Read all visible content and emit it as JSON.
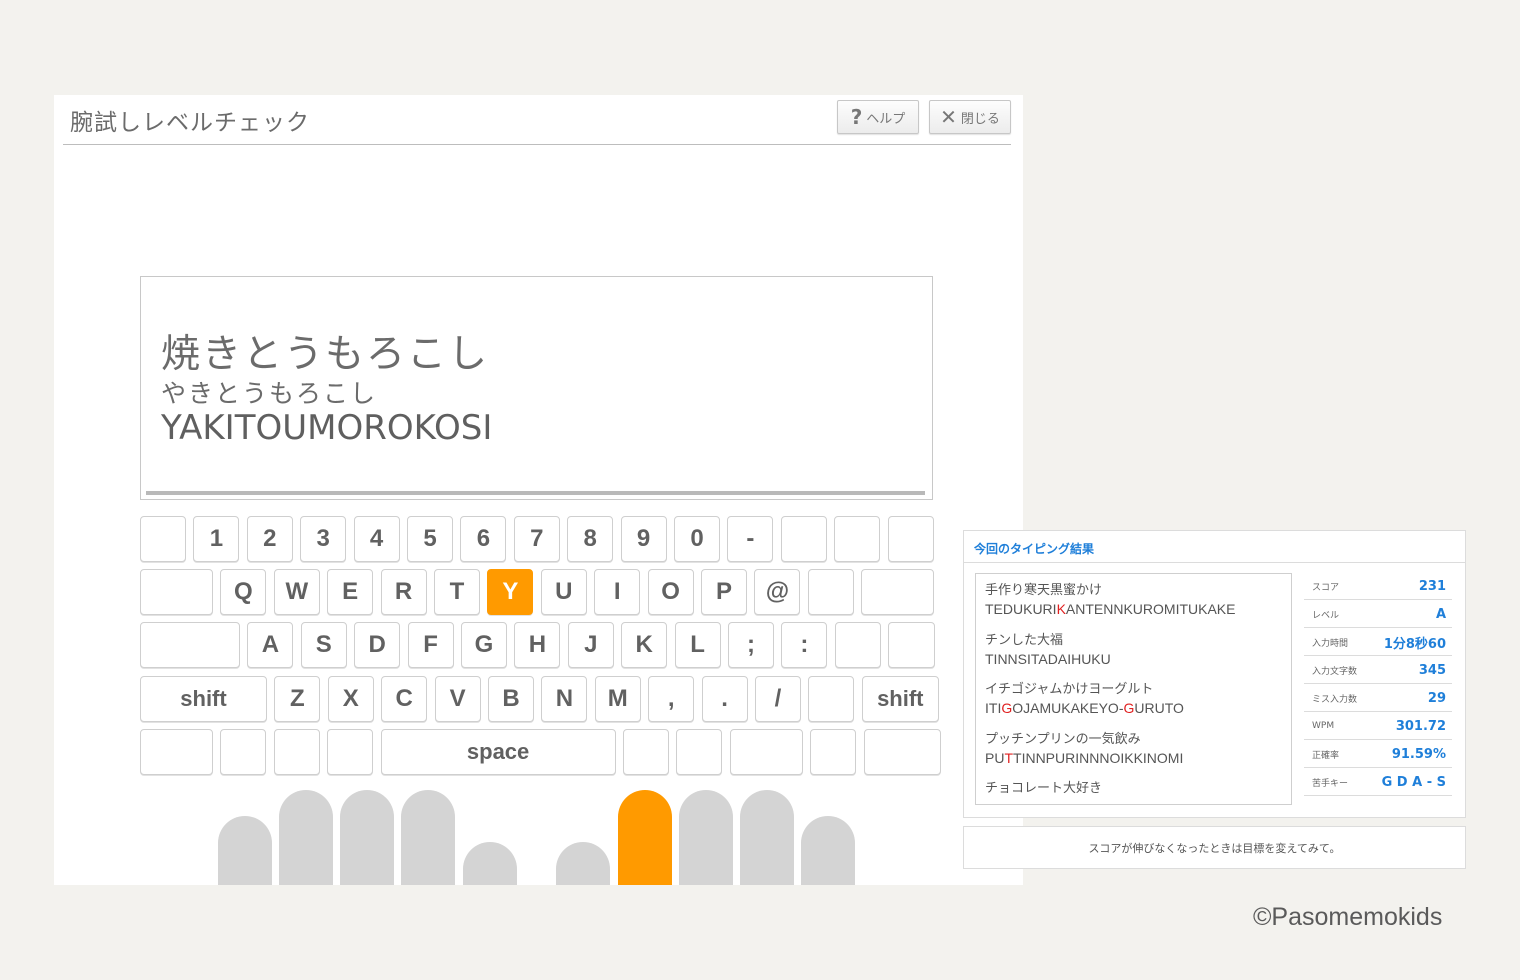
{
  "header": {
    "title": "腕試しレベルチェック",
    "help_icon": "?",
    "help_label": "ヘルプ",
    "close_icon": "✕",
    "close_label": "閉じる"
  },
  "word": {
    "kanji": "焼きとうもろこし",
    "kana": "やきとうもろこし",
    "romaji": "YAKITOUMOROKOSI",
    "progress": 1.0
  },
  "keyboard": {
    "active_key": "Y",
    "row1": [
      "",
      "1",
      "2",
      "3",
      "4",
      "5",
      "6",
      "7",
      "8",
      "9",
      "0",
      "-",
      "",
      "",
      ""
    ],
    "row2": [
      "",
      "Q",
      "W",
      "E",
      "R",
      "T",
      "Y",
      "U",
      "I",
      "O",
      "P",
      "@",
      "",
      ""
    ],
    "row3": [
      "",
      "A",
      "S",
      "D",
      "F",
      "G",
      "H",
      "J",
      "K",
      "L",
      ";",
      ":",
      "",
      ""
    ],
    "row4": [
      "shift",
      "Z",
      "X",
      "C",
      "V",
      "B",
      "N",
      "M",
      ",",
      ".",
      "/",
      "",
      "shift"
    ],
    "row5": [
      "",
      "",
      "",
      "",
      "space",
      "",
      "",
      "",
      "",
      ""
    ]
  },
  "fingers": {
    "active_index": 6
  },
  "result": {
    "title": "今回のタイピング結果",
    "words": [
      {
        "jp": "手作り寒天黒蜜かけ",
        "romaji": [
          {
            "t": "TEDUKURI"
          },
          {
            "t": "K",
            "miss": true
          },
          {
            "t": "ANTENNKUROMITUKAKE"
          }
        ]
      },
      {
        "jp": "チンした大福",
        "romaji": [
          {
            "t": "TINNSITADAIHUKU"
          }
        ]
      },
      {
        "jp": "イチゴジャムかけヨーグルト",
        "romaji": [
          {
            "t": "ITI"
          },
          {
            "t": "G",
            "miss": true
          },
          {
            "t": "OJAMUKAKEYO-"
          },
          {
            "t": "G",
            "miss": true
          },
          {
            "t": "URUTO"
          }
        ]
      },
      {
        "jp": "プッチンプリンの一気飲み",
        "romaji": [
          {
            "t": "PU"
          },
          {
            "t": "T",
            "miss": true
          },
          {
            "t": "TINNPURINNNOIKKINOMI"
          }
        ]
      },
      {
        "jp": "チョコレート大好き",
        "romaji": []
      }
    ],
    "stats": [
      {
        "label": "スコア",
        "value": "231"
      },
      {
        "label": "レベル",
        "value": "A"
      },
      {
        "label": "入力時間",
        "value": "1分8秒60"
      },
      {
        "label": "入力文字数",
        "value": "345"
      },
      {
        "label": "ミス入力数",
        "value": "29"
      },
      {
        "label": "WPM",
        "value": "301.72"
      },
      {
        "label": "正確率",
        "value": "91.59%"
      },
      {
        "label": "苦手キー",
        "value": "G D A - S"
      }
    ],
    "tip": "スコアが伸びなくなったときは目標を変えてみて。"
  },
  "copyright": "©Pasomemokids",
  "colors": {
    "accent": "#ff9a00",
    "link_blue": "#1f7fd9",
    "miss_red": "#e02020"
  }
}
